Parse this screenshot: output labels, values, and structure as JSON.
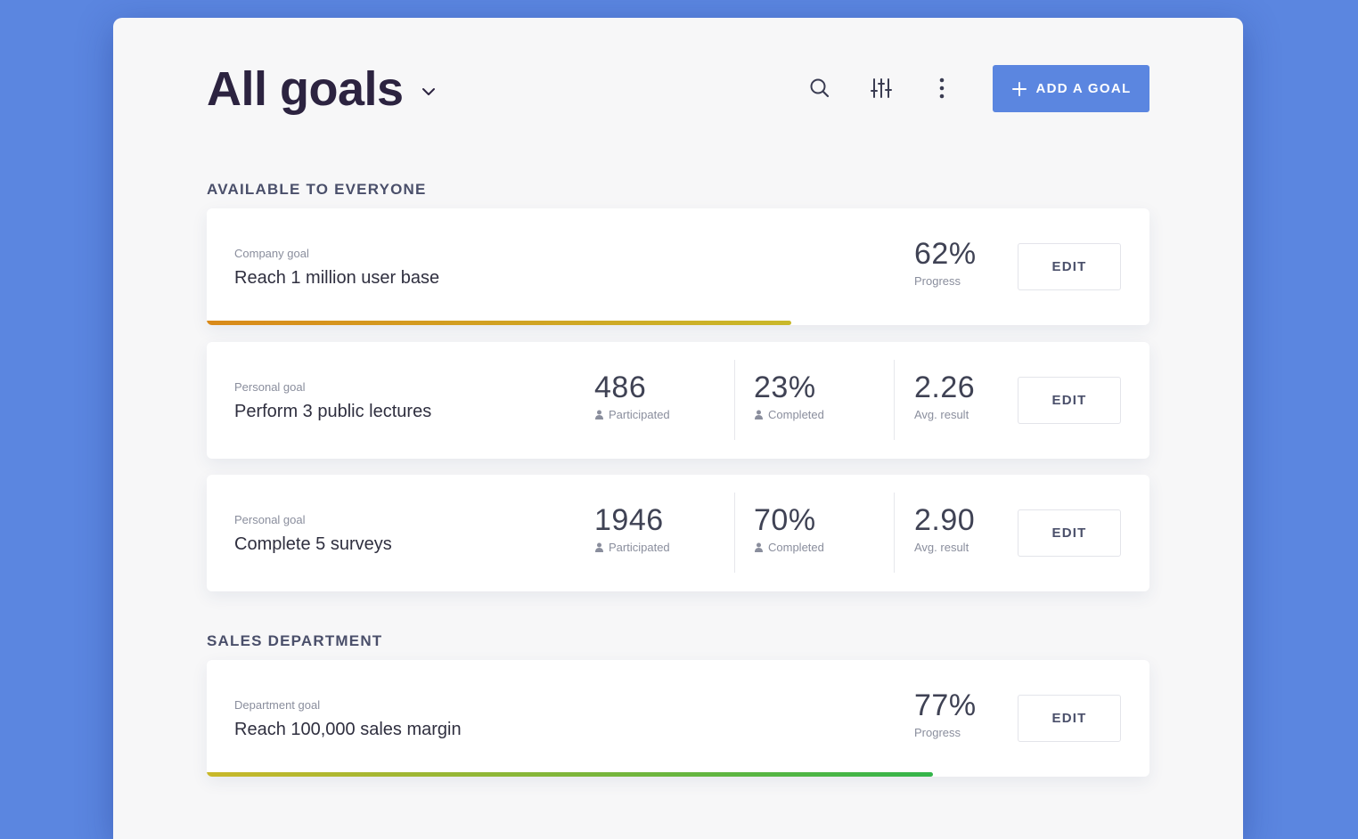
{
  "header": {
    "title": "All goals",
    "add_button_label": "ADD A GOAL"
  },
  "sections": [
    {
      "title": "AVAILABLE TO EVERYONE",
      "cards": [
        {
          "type": "Company goal",
          "name": "Reach 1 million user base",
          "progress_value": "62%",
          "progress_label": "Progress",
          "progress_fraction": 0.62,
          "bar_colors": [
            "#d98a1a",
            "#c9b82a"
          ],
          "edit_label": "EDIT"
        },
        {
          "type": "Personal goal",
          "name": "Perform 3 public lectures",
          "participated": "486",
          "participated_label": "Participated",
          "completed": "23%",
          "completed_label": "Completed",
          "avg_result": "2.26",
          "avg_label": "Avg. result",
          "edit_label": "EDIT"
        },
        {
          "type": "Personal goal",
          "name": "Complete 5 surveys",
          "participated": "1946",
          "participated_label": "Participated",
          "completed": "70%",
          "completed_label": "Completed",
          "avg_result": "2.90",
          "avg_label": "Avg. result",
          "edit_label": "EDIT"
        }
      ]
    },
    {
      "title": "SALES DEPARTMENT",
      "cards": [
        {
          "type": "Department goal",
          "name": "Reach 100,000 sales margin",
          "progress_value": "77%",
          "progress_label": "Progress",
          "progress_fraction": 0.77,
          "bar_colors": [
            "#c9b82a",
            "#34b54a"
          ],
          "edit_label": "EDIT"
        }
      ]
    }
  ],
  "icons": {
    "title_chevron": "chevron-down-icon",
    "search": "search-icon",
    "filter": "sliders-icon",
    "more": "more-vertical-icon",
    "add": "plus-icon",
    "person": "person-icon"
  },
  "colors": {
    "accent": "#5b86e0",
    "title": "#2c2340"
  }
}
